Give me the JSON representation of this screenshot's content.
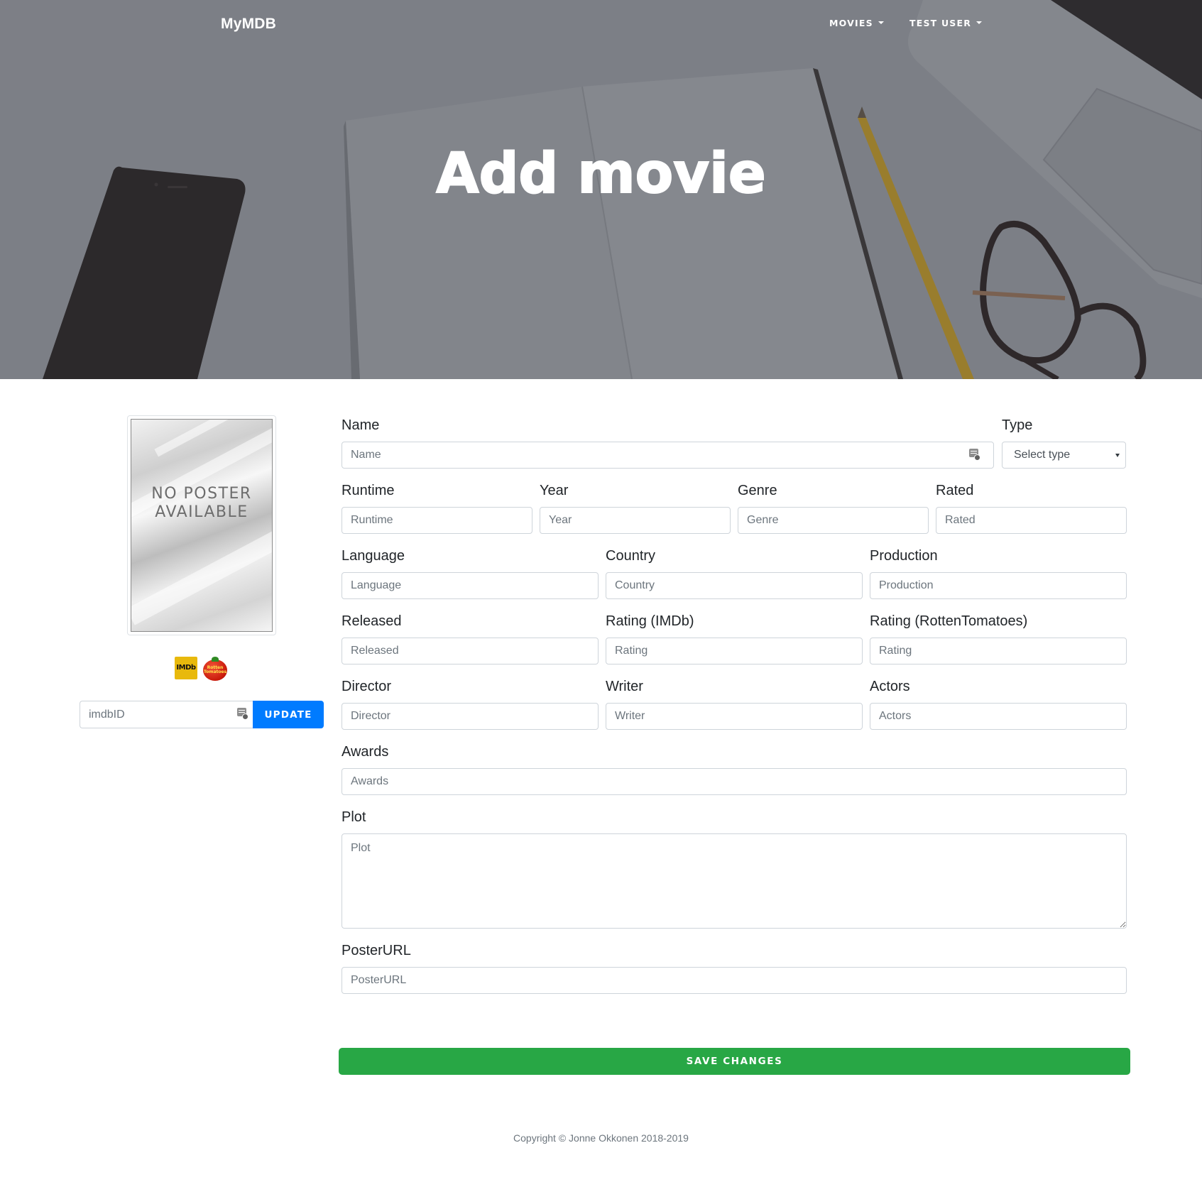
{
  "nav": {
    "brand": "MyMDB",
    "movies_label": "MOVIES",
    "user_label": "TEST USER"
  },
  "hero": {
    "title": "Add movie"
  },
  "poster": {
    "placeholder_line1": "NO POSTER",
    "placeholder_line2": "AVAILABLE"
  },
  "logos": {
    "imdb": "IMDb",
    "rotten_tomatoes": "Rotten Tomatoes"
  },
  "imdb_lookup": {
    "placeholder": "imdbID",
    "value": "",
    "button_label": "UPDATE"
  },
  "form": {
    "name": {
      "label": "Name",
      "placeholder": "Name"
    },
    "type": {
      "label": "Type",
      "selected": "Select type"
    },
    "runtime": {
      "label": "Runtime",
      "placeholder": "Runtime"
    },
    "year": {
      "label": "Year",
      "placeholder": "Year"
    },
    "genre": {
      "label": "Genre",
      "placeholder": "Genre"
    },
    "rated": {
      "label": "Rated",
      "placeholder": "Rated"
    },
    "language": {
      "label": "Language",
      "placeholder": "Language"
    },
    "country": {
      "label": "Country",
      "placeholder": "Country"
    },
    "production": {
      "label": "Production",
      "placeholder": "Production"
    },
    "released": {
      "label": "Released",
      "placeholder": "Released"
    },
    "rating_imdb": {
      "label": "Rating (IMDb)",
      "placeholder": "Rating"
    },
    "rating_rt": {
      "label": "Rating (RottenTomatoes)",
      "placeholder": "Rating"
    },
    "director": {
      "label": "Director",
      "placeholder": "Director"
    },
    "writer": {
      "label": "Writer",
      "placeholder": "Writer"
    },
    "actors": {
      "label": "Actors",
      "placeholder": "Actors"
    },
    "awards": {
      "label": "Awards",
      "placeholder": "Awards"
    },
    "plot": {
      "label": "Plot",
      "placeholder": "Plot"
    },
    "poster_url": {
      "label": "PosterURL",
      "placeholder": "PosterURL"
    },
    "save_label": "SAVE CHANGES"
  },
  "footer": {
    "copyright": "Copyright © Jonne Okkonen 2018-2019"
  },
  "icons": {
    "field_autofill": "autofill-card-icon",
    "nav_caret": "caret-down-icon"
  },
  "colors": {
    "primary": "#007bff",
    "success": "#28a745",
    "imdb_yellow": "#e8b90c",
    "hero_overlay": "#868991"
  }
}
